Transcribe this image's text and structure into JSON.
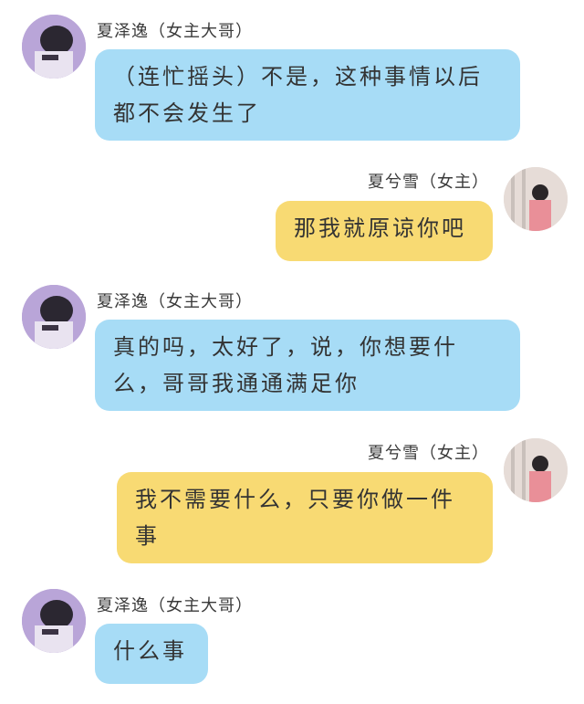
{
  "messages": [
    {
      "side": "left",
      "sender": "夏泽逸（女主大哥）",
      "text": "（连忙摇头）不是，这种事情以后都不会发生了",
      "avatar_icon": "boy-avatar-icon"
    },
    {
      "side": "right",
      "sender": "夏兮雪（女主）",
      "text": "那我就原谅你吧",
      "avatar_icon": "girl-avatar-icon"
    },
    {
      "side": "left",
      "sender": "夏泽逸（女主大哥）",
      "text": "真的吗，太好了，说，你想要什么，哥哥我通通满足你",
      "avatar_icon": "boy-avatar-icon"
    },
    {
      "side": "right",
      "sender": "夏兮雪（女主）",
      "text": "我不需要什么，只要你做一件事",
      "avatar_icon": "girl-avatar-icon"
    },
    {
      "side": "left",
      "sender": "夏泽逸（女主大哥）",
      "text": "什么事",
      "avatar_icon": "boy-avatar-icon"
    }
  ],
  "colors": {
    "left_bubble": "#a7dcf6",
    "right_bubble": "#f8da73",
    "background": "#ffffff"
  }
}
